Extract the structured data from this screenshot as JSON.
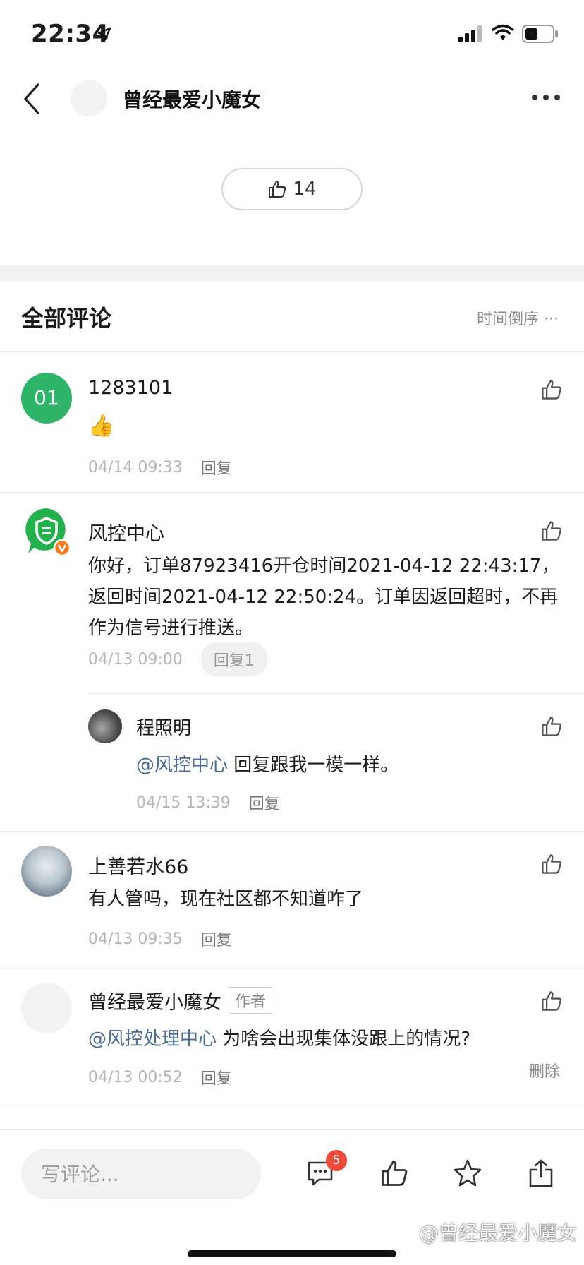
{
  "status_bar": {
    "time": "22:34"
  },
  "nav": {
    "title": "曾经最爱小魔女"
  },
  "post": {
    "like_count": "14"
  },
  "comments_section": {
    "title": "全部评论",
    "sort_label": "时间倒序 ···"
  },
  "comments": [
    {
      "avatar_text": "01",
      "name": "1283101",
      "body": "👍",
      "time": "04/14 09:33",
      "reply_label": "回复"
    },
    {
      "name": "风控中心",
      "body": "你好，订单87923416开仓时间2021-04-12 22:43:17，返回时间2021-04-12 22:50:24。订单因返回超时，不再作为信号进行推送。",
      "time": "04/13 09:00",
      "reply_label": "回复1",
      "sub_reply": {
        "name": "程照明",
        "mention": "@风控中心",
        "body": " 回复跟我一模一样。",
        "time": "04/15 13:39",
        "reply_label": "回复"
      }
    },
    {
      "name": "上善若水66",
      "body": "有人管吗，现在社区都不知道咋了",
      "time": "04/13 09:35",
      "reply_label": "回复"
    },
    {
      "name": "曾经最爱小魔女",
      "author_tag": "作者",
      "mention": "@风控处理中心",
      "body": " 为啥会出现集体没跟上的情况?",
      "time": "04/13 00:52",
      "reply_label": "回复",
      "delete_label": "删除"
    }
  ],
  "bottom_bar": {
    "input_placeholder": "写评论...",
    "comment_badge": "5",
    "watermark": "@曾经最爱小魔女"
  },
  "colors": {
    "accent_green": "#2fb56a",
    "mention_blue": "#4a6a9a",
    "badge_red": "#f04a3a"
  }
}
